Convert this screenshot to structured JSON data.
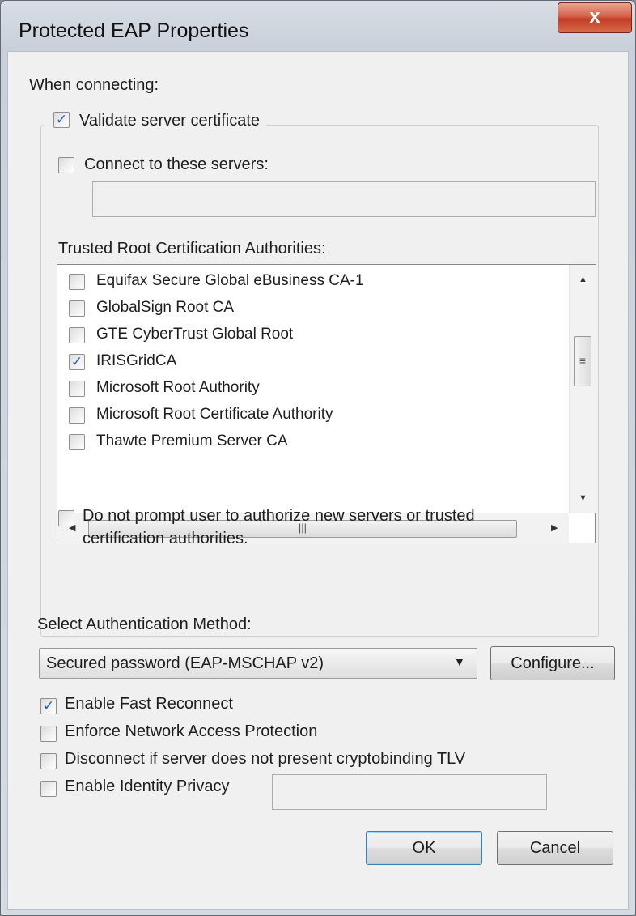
{
  "window": {
    "title": "Protected EAP Properties",
    "close_glyph": "x"
  },
  "connecting": {
    "heading": "When connecting:",
    "validate_server_certificate": {
      "label": "Validate server certificate",
      "checked": true
    },
    "connect_to_servers": {
      "label": "Connect to these servers:",
      "checked": false,
      "value": ""
    },
    "trusted_root_label": "Trusted Root Certification Authorities:",
    "authorities": [
      {
        "label": "Equifax Secure Global eBusiness CA-1",
        "checked": false
      },
      {
        "label": "GlobalSign Root CA",
        "checked": false
      },
      {
        "label": "GTE CyberTrust Global Root",
        "checked": false
      },
      {
        "label": "IRISGridCA",
        "checked": true
      },
      {
        "label": "Microsoft Root Authority",
        "checked": false
      },
      {
        "label": "Microsoft Root Certificate Authority",
        "checked": false
      },
      {
        "label": "Thawte Premium Server CA",
        "checked": false
      }
    ],
    "do_not_prompt": {
      "label_line1": "Do not prompt user to authorize new servers or trusted",
      "label_line2": "certification authorities.",
      "checked": false
    }
  },
  "auth": {
    "label": "Select Authentication Method:",
    "selected": "Secured password (EAP-MSCHAP v2)",
    "configure_button": "Configure..."
  },
  "options": [
    {
      "label": "Enable Fast Reconnect",
      "checked": true
    },
    {
      "label": "Enforce Network Access Protection",
      "checked": false
    },
    {
      "label": "Disconnect if server does not present cryptobinding TLV",
      "checked": false
    },
    {
      "label": "Enable Identity Privacy",
      "checked": false
    }
  ],
  "identity_privacy_value": "",
  "buttons": {
    "ok": "OK",
    "cancel": "Cancel"
  },
  "colors": {
    "client_bg": "#f0f0f0",
    "close_red": "#c23d25",
    "check_blue": "#2a5db0"
  }
}
